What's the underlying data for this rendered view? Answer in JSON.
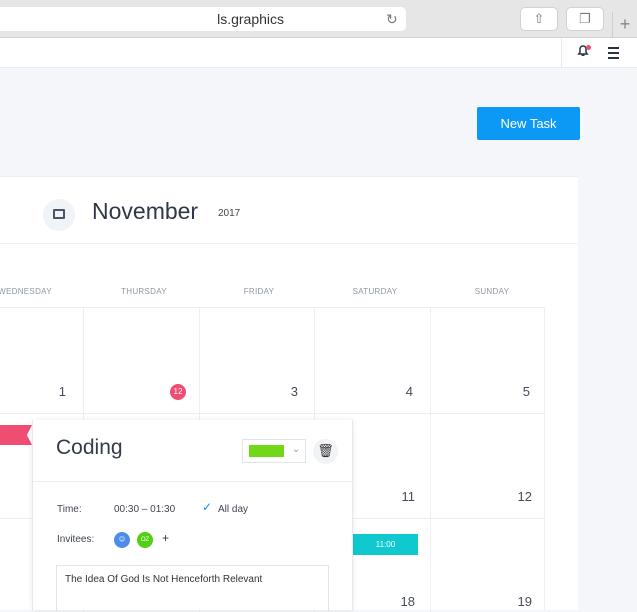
{
  "browser": {
    "url": "ls.graphics",
    "plus": "+"
  },
  "header": {},
  "actions": {
    "new_task": "New Task"
  },
  "calendar": {
    "month": "November",
    "year": "2017",
    "days": [
      "WEDNESDAY",
      "THURSDAY",
      "FRIDAY",
      "SATURDAY",
      "SUNDAY"
    ],
    "dates": [
      "1",
      "12",
      "3",
      "4",
      "5",
      "11",
      "12",
      "18",
      "19"
    ]
  },
  "event": {
    "title": "Coding",
    "time_label": "Time:",
    "time_value": "00:30 – 01:30",
    "allday": "All day",
    "invitees_label": "Invitees:",
    "avatar2": "OZ",
    "plus": "+",
    "note": "The Idea Of God Is Not Henceforth Relevant",
    "color": "#71d716"
  },
  "calendar_event": {
    "time": "11:00",
    "color": "#10c9cf"
  },
  "colors": {
    "accent": "#0c99f5",
    "today": "#f04d72"
  }
}
